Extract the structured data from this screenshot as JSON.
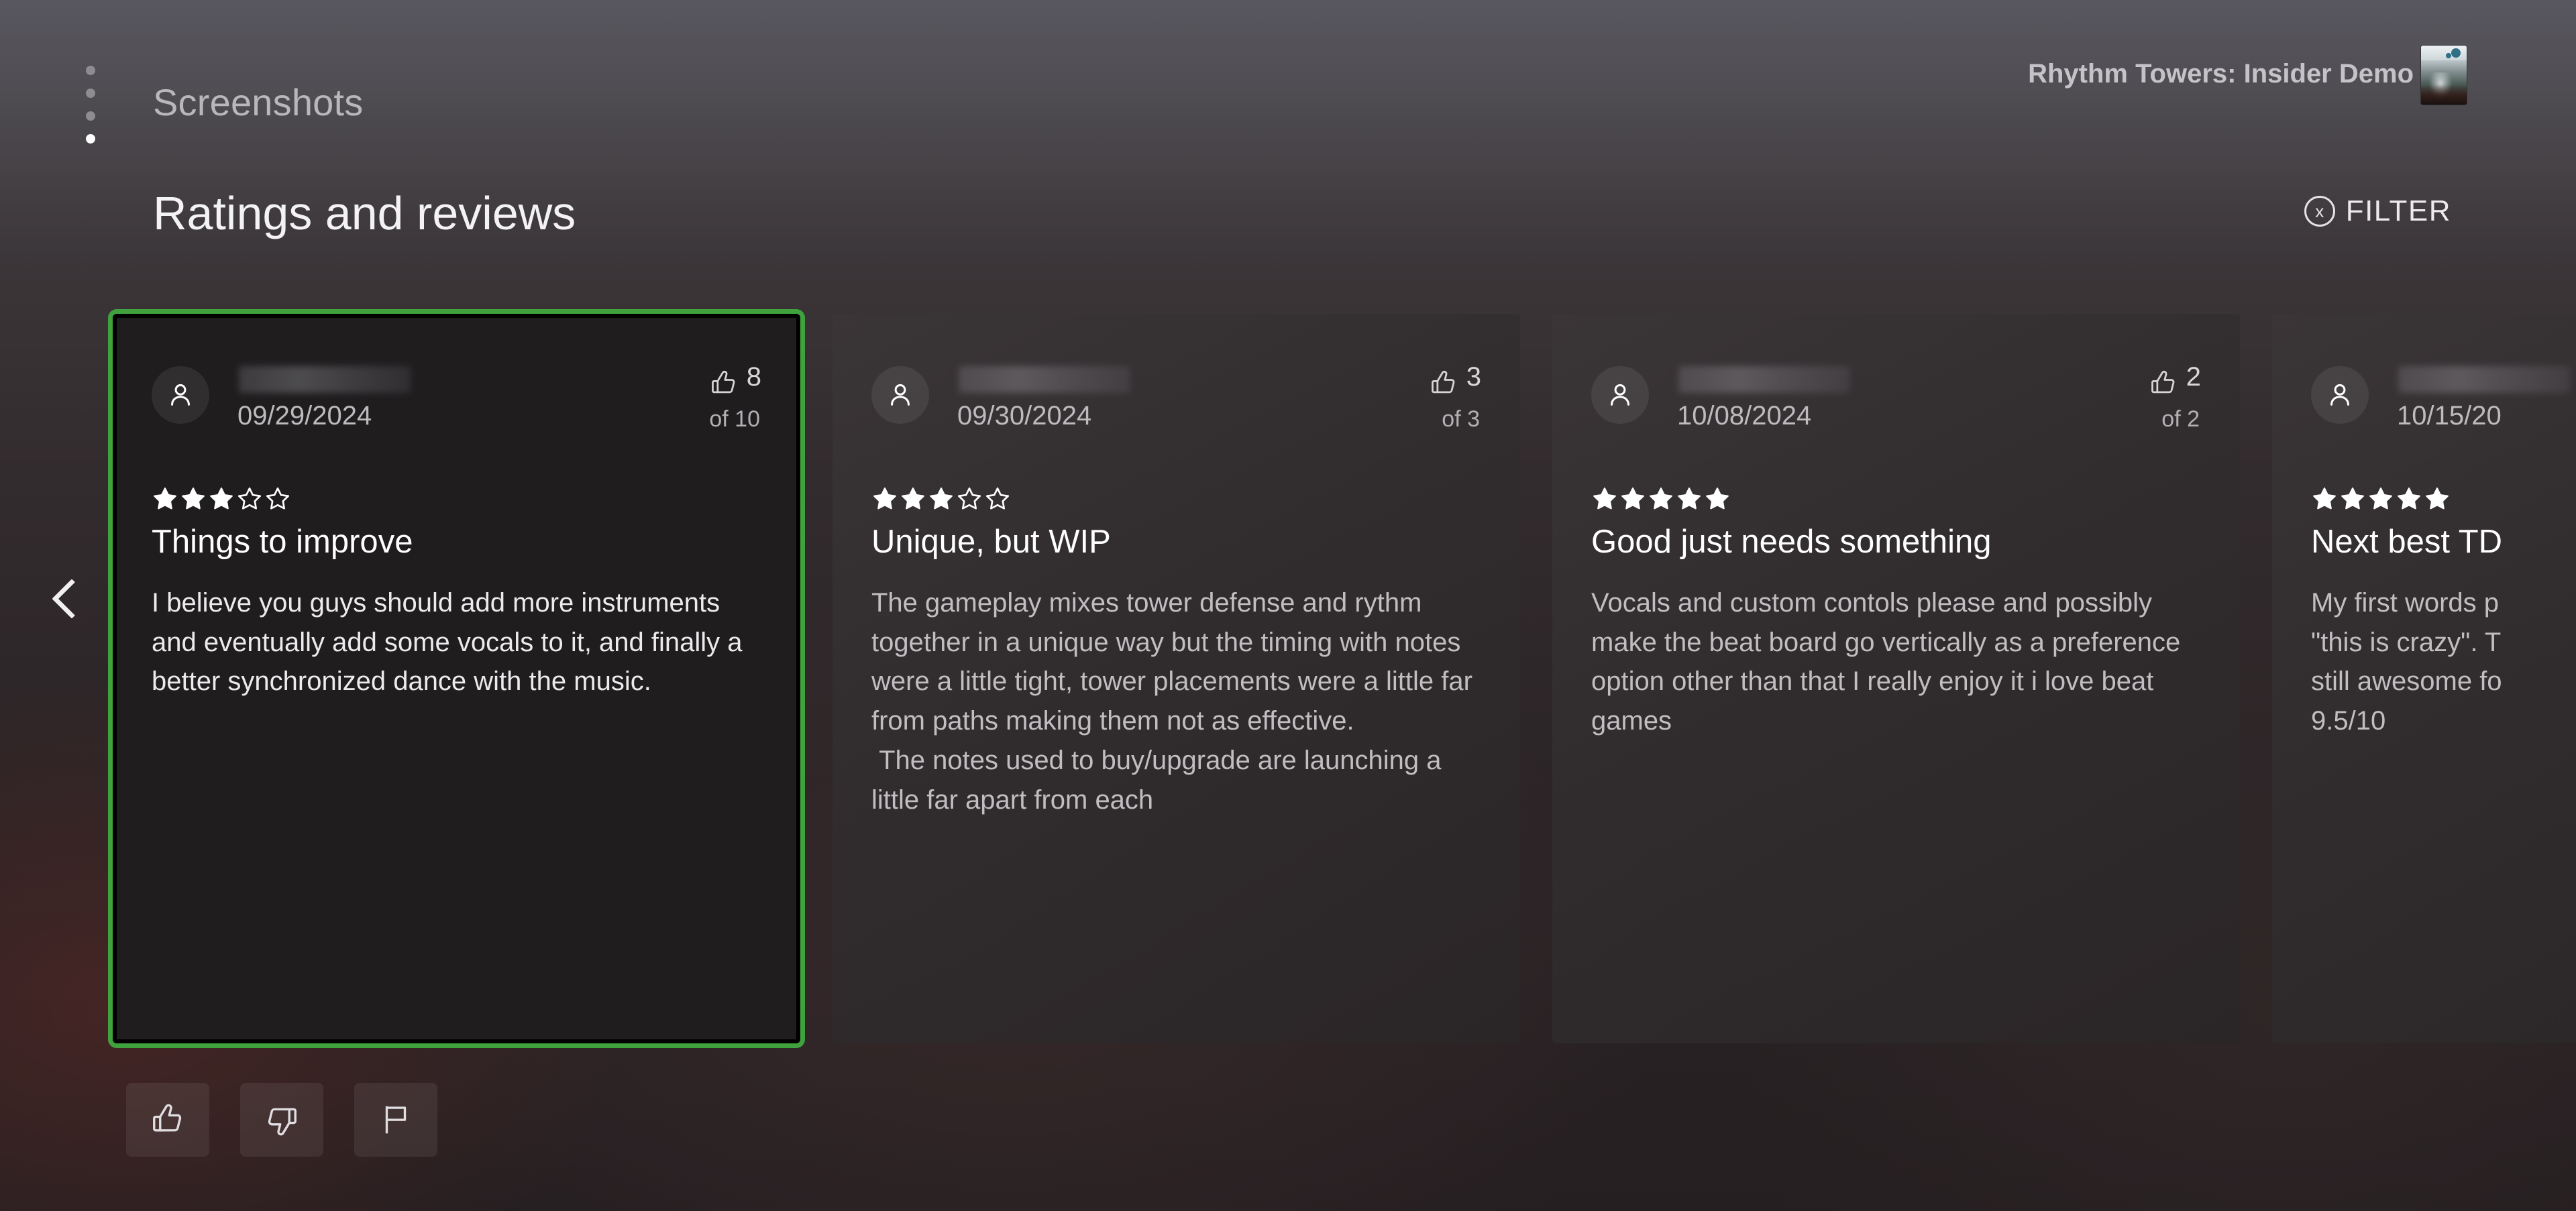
{
  "header": {
    "breadcrumb": "Screenshots",
    "game_title": "Rhythm Towers: Insider Demo",
    "page_dots": 4,
    "active_dot_index": 3
  },
  "section": {
    "title": "Ratings and reviews",
    "filter_button": "FILTER",
    "filter_button_glyph": "x"
  },
  "nav": {
    "prev_label": "Previous"
  },
  "reviews": [
    {
      "username": "",
      "date": "09/29/2024",
      "rating": 3,
      "max_rating": 5,
      "helpful_count": "8",
      "helpful_of": "of 10",
      "title": "Things to improve",
      "body": "I believe you guys should add more instruments and eventually add some vocals to it, and finally a better synchronized dance with the music.",
      "selected": true
    },
    {
      "username": "",
      "date": "09/30/2024",
      "rating": 3,
      "max_rating": 5,
      "helpful_count": "3",
      "helpful_of": "of 3",
      "title": "Unique, but WIP",
      "body": "The gameplay mixes tower defense and rythm together in a unique way but the timing with notes were a little tight, tower placements were a little far from paths making them not as effective.\n The notes used to buy/upgrade are launching a little far apart from each",
      "selected": false
    },
    {
      "username": "",
      "date": "10/08/2024",
      "rating": 5,
      "max_rating": 5,
      "helpful_count": "2",
      "helpful_of": "of 2",
      "title": "Good just needs something",
      "body": "Vocals and custom contols please and possibly make the beat board go vertically as a preference option other than that I really enjoy it i love beat games",
      "selected": false
    },
    {
      "username": "",
      "date": "10/15/20",
      "rating": 5,
      "max_rating": 5,
      "helpful_count": "",
      "helpful_of": "",
      "title": "Next best TD",
      "body": "My first words p\n\"this is crazy\". T\nstill awesome fo\n9.5/10",
      "selected": false
    }
  ],
  "footer_actions": [
    {
      "icon": "thumbs-up-icon",
      "label": "Like"
    },
    {
      "icon": "thumbs-down-icon",
      "label": "Dislike"
    },
    {
      "icon": "flag-icon",
      "label": "Report"
    }
  ],
  "colors": {
    "focus_green": "#3fa23d",
    "card_bg": "#332e30",
    "selected_card_bg": "#1f1d1e",
    "text_primary": "#ffffff",
    "text_secondary": "#c0bec1"
  }
}
